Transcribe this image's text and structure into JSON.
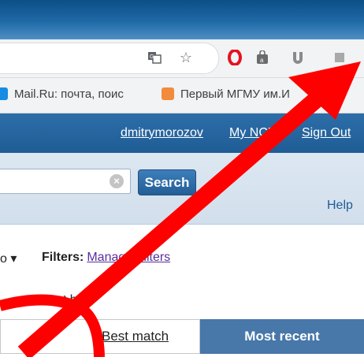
{
  "bookmarks": [
    {
      "label": "Mail.Ru: почта, поис",
      "icon": "mailru-icon",
      "color": "#168de2"
    },
    {
      "label": "Первый МГМУ им.И",
      "icon": "bookmark-page-icon",
      "color": "#f28b3c"
    }
  ],
  "userbar": {
    "username": "dmitrymorozov",
    "my_ncbi": "My NCBI",
    "sign_out": "Sign Out"
  },
  "search": {
    "button_label": "Search",
    "help_label": "Help"
  },
  "results": {
    "sort_dropdown": "o ▾",
    "filters_label": "Filters:",
    "manage_filters": "Manage Filters",
    "sort_label": "Sort by:",
    "best_match": "Best match",
    "most_recent": "Most recent"
  },
  "colors": {
    "ncbi_blue": "#1f5c96",
    "annotation_red": "#ff0000",
    "active_tab": "#4877a9"
  }
}
